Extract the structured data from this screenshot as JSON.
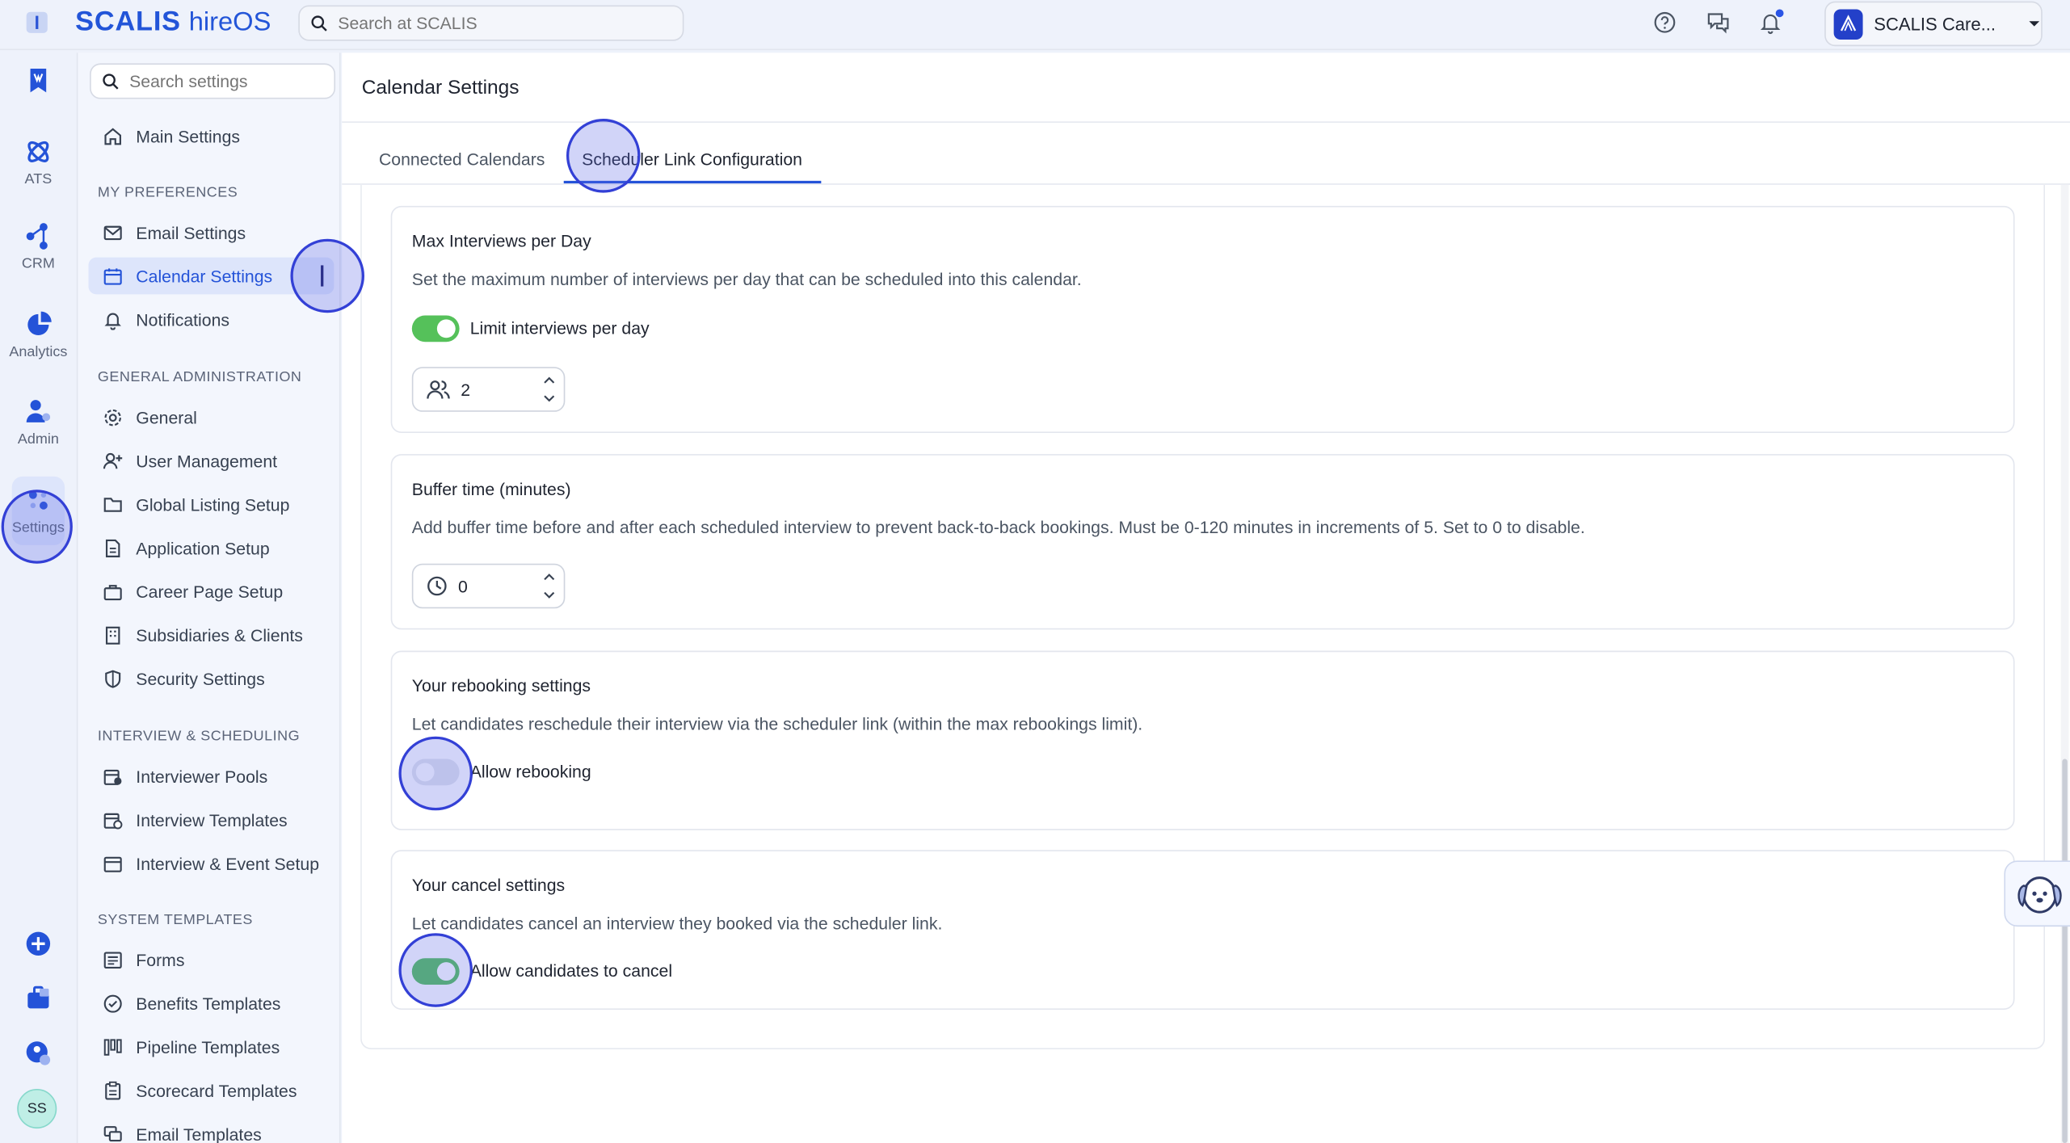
{
  "app": {
    "brand": "SCALIS",
    "product": "hireOS",
    "search_placeholder": "Search at SCALIS",
    "account_name": "SCALIS Care..."
  },
  "rail": {
    "items": [
      {
        "label": "",
        "icon": "bookmark-icon"
      },
      {
        "label": "ATS",
        "icon": "ats-icon"
      },
      {
        "label": "CRM",
        "icon": "crm-icon"
      },
      {
        "label": "Analytics",
        "icon": "analytics-icon"
      },
      {
        "label": "Admin",
        "icon": "admin-icon"
      },
      {
        "label": "Settings",
        "icon": "settings-icon"
      }
    ],
    "avatar_initials": "SS"
  },
  "settings_nav": {
    "search_placeholder": "Search settings",
    "main_settings": "Main Settings",
    "sections": [
      {
        "heading": "MY PREFERENCES",
        "items": [
          "Email Settings",
          "Calendar Settings",
          "Notifications"
        ]
      },
      {
        "heading": "GENERAL ADMINISTRATION",
        "items": [
          "General",
          "User Management",
          "Global Listing Setup",
          "Application Setup",
          "Career Page Setup",
          "Subsidiaries & Clients",
          "Security Settings"
        ]
      },
      {
        "heading": "INTERVIEW & SCHEDULING",
        "items": [
          "Interviewer Pools",
          "Interview Templates",
          "Interview & Event Setup"
        ]
      },
      {
        "heading": "SYSTEM TEMPLATES",
        "items": [
          "Forms",
          "Benefits Templates",
          "Pipeline Templates",
          "Scorecard Templates",
          "Email Templates"
        ]
      }
    ]
  },
  "main": {
    "title": "Calendar Settings",
    "tabs": [
      "Connected Calendars",
      "Scheduler Link Configuration"
    ],
    "max_interviews": {
      "title": "Max Interviews per Day",
      "desc": "Set the maximum number of interviews per day that can be scheduled into this calendar.",
      "toggle_label": "Limit interviews per day",
      "toggle_on": true,
      "value": "2"
    },
    "buffer": {
      "title": "Buffer time (minutes)",
      "desc": "Add buffer time before and after each scheduled interview to prevent back-to-back bookings. Must be 0-120 minutes in increments of 5. Set to 0 to disable.",
      "value": "0"
    },
    "rebooking": {
      "title": "Your rebooking settings",
      "desc": "Let candidates reschedule their interview via the scheduler link (within the max rebookings limit).",
      "toggle_label": "Allow rebooking",
      "toggle_on": false
    },
    "cancel": {
      "title": "Your cancel settings",
      "desc": "Let candidates cancel an interview they booked via the scheduler link.",
      "toggle_label": "Allow candidates to cancel",
      "toggle_on": true
    }
  },
  "colors": {
    "accent": "#2453d8",
    "toggle_on": "#55c15a",
    "highlight": "#3340d6"
  }
}
